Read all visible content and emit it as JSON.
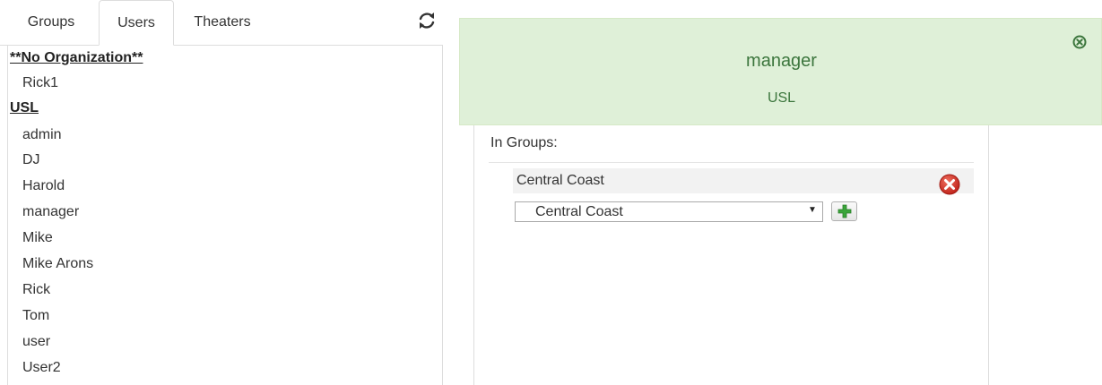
{
  "tabs": [
    {
      "label": "Groups",
      "active": false
    },
    {
      "label": "Users",
      "active": true
    },
    {
      "label": "Theaters",
      "active": false
    }
  ],
  "icons": {
    "refresh": "refresh-icon",
    "close": "close-circle-icon",
    "remove": "remove-red-x-icon",
    "add": "green-plus-icon"
  },
  "organizations": [
    {
      "name": "**No Organization**",
      "users": [
        "Rick1"
      ]
    },
    {
      "name": "USL",
      "users": [
        "admin",
        "DJ",
        "Harold",
        "manager",
        "Mike",
        "Mike Arons",
        "Rick",
        "Tom",
        "user",
        "User2"
      ]
    }
  ],
  "detail": {
    "name": "manager",
    "organization": "USL",
    "in_groups_label": "In Groups:",
    "groups": [
      "Central Coast"
    ],
    "select_value": "Central Coast"
  },
  "colors": {
    "header_bg": "#dff0d8",
    "header_text": "#3c763d",
    "remove_red": "#d9342b",
    "add_green": "#3aa53a"
  }
}
